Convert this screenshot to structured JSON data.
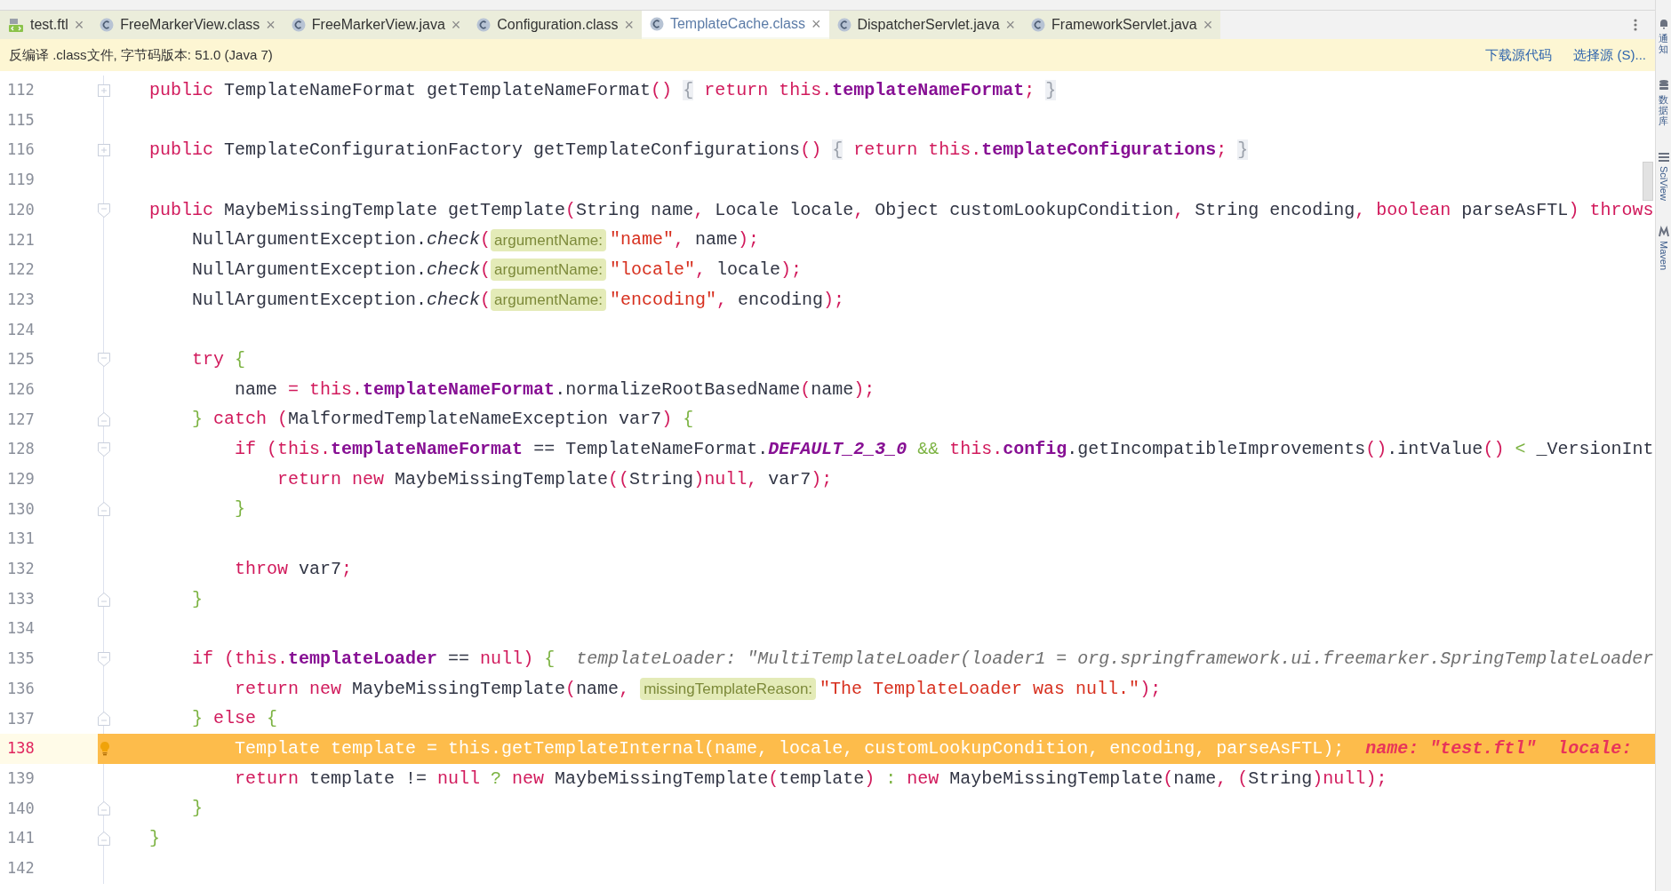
{
  "tabs": [
    {
      "label": "test.ftl",
      "kind": "ftl",
      "close": "×",
      "selected": false
    },
    {
      "label": "FreeMarkerView.class",
      "kind": "class",
      "close": "×",
      "selected": false
    },
    {
      "label": "FreeMarkerView.java",
      "kind": "class",
      "close": "×",
      "selected": false
    },
    {
      "label": "Configuration.class",
      "kind": "class",
      "close": "×",
      "selected": false
    },
    {
      "label": "TemplateCache.class",
      "kind": "class",
      "close": "×",
      "selected": true
    },
    {
      "label": "DispatcherServlet.java",
      "kind": "class",
      "close": "×",
      "selected": false
    },
    {
      "label": "FrameworkServlet.java",
      "kind": "class",
      "close": "×",
      "selected": false
    }
  ],
  "notice": {
    "text": "反编译 .class文件, 字节码版本: 51.0 (Java 7)",
    "actions": [
      "下载源代码",
      "选择源 (S)..."
    ]
  },
  "side_tools": [
    {
      "label": "通知",
      "kind": "bell"
    },
    {
      "label": "数据库",
      "kind": "database"
    },
    {
      "label": "SciView",
      "kind": "grid"
    },
    {
      "label": "Maven",
      "kind": "maven"
    }
  ],
  "lines": [
    {
      "number": "112",
      "kind": "collapsed",
      "current": false,
      "tokens": [
        {
          "kind": "kw",
          "text": "public"
        },
        {
          "kind": "plain",
          "text": " TemplateNameFormat getTemplateNameFormat"
        },
        {
          "kind": "paren",
          "text": "() "
        },
        {
          "kind": "folded",
          "text": "{"
        },
        {
          "kind": "kw",
          "text": " return this"
        },
        {
          "kind": "paren",
          "text": "."
        },
        {
          "kind": "field",
          "text": "templateNameFormat"
        },
        {
          "kind": "paren",
          "text": "; "
        },
        {
          "kind": "folded",
          "text": "}"
        }
      ]
    },
    {
      "number": "115",
      "kind": "plain",
      "current": false
    },
    {
      "number": "116",
      "kind": "collapsed",
      "current": false,
      "tokens": [
        {
          "kind": "kw",
          "text": "public"
        },
        {
          "kind": "plain",
          "text": " TemplateConfigurationFactory getTemplateConfigurations"
        },
        {
          "kind": "paren",
          "text": "() "
        },
        {
          "kind": "folded",
          "text": "{"
        },
        {
          "kind": "kw",
          "text": " return this"
        },
        {
          "kind": "paren",
          "text": "."
        },
        {
          "kind": "field",
          "text": "templateConfigurations"
        },
        {
          "kind": "paren",
          "text": "; "
        },
        {
          "kind": "folded",
          "text": "}"
        }
      ]
    },
    {
      "number": "119",
      "kind": "plain",
      "current": false
    },
    {
      "number": "120",
      "kind": "fold_start",
      "current": false,
      "tokens": [
        {
          "kind": "kw",
          "text": "public"
        },
        {
          "kind": "plain",
          "text": " MaybeMissingTemplate getTemplate"
        },
        {
          "kind": "paren",
          "text": "("
        },
        {
          "kind": "plain",
          "text": "String name"
        },
        {
          "kind": "paren",
          "text": ","
        },
        {
          "kind": "plain",
          "text": " Locale locale"
        },
        {
          "kind": "paren",
          "text": ","
        },
        {
          "kind": "plain",
          "text": " Object customLookupCondition"
        },
        {
          "kind": "paren",
          "text": ","
        },
        {
          "kind": "plain",
          "text": " String encoding"
        },
        {
          "kind": "paren",
          "text": ","
        },
        {
          "kind": "kw",
          "text": " boolean"
        },
        {
          "kind": "plain",
          "text": " parseAsFTL"
        },
        {
          "kind": "paren",
          "text": ")"
        },
        {
          "kind": "kw",
          "text": " throws"
        }
      ]
    },
    {
      "number": "121",
      "kind": "plain",
      "current": false,
      "tokens": [
        {
          "kind": "plain",
          "text": "    NullArgumentException."
        },
        {
          "kind": "italic",
          "text": "check"
        },
        {
          "kind": "paren",
          "text": "("
        },
        {
          "kind": "hint",
          "text": "argumentName:"
        },
        {
          "kind": "str",
          "text": "\"name\""
        },
        {
          "kind": "paren",
          "text": ","
        },
        {
          "kind": "plain",
          "text": " name"
        },
        {
          "kind": "paren",
          "text": ");"
        }
      ]
    },
    {
      "number": "122",
      "kind": "plain",
      "current": false,
      "tokens": [
        {
          "kind": "plain",
          "text": "    NullArgumentException."
        },
        {
          "kind": "italic",
          "text": "check"
        },
        {
          "kind": "paren",
          "text": "("
        },
        {
          "kind": "hint",
          "text": "argumentName:"
        },
        {
          "kind": "str",
          "text": "\"locale\""
        },
        {
          "kind": "paren",
          "text": ","
        },
        {
          "kind": "plain",
          "text": " locale"
        },
        {
          "kind": "paren",
          "text": ");"
        }
      ]
    },
    {
      "number": "123",
      "kind": "plain",
      "current": false,
      "tokens": [
        {
          "kind": "plain",
          "text": "    NullArgumentException."
        },
        {
          "kind": "italic",
          "text": "check"
        },
        {
          "kind": "paren",
          "text": "("
        },
        {
          "kind": "hint",
          "text": "argumentName:"
        },
        {
          "kind": "str",
          "text": "\"encoding\""
        },
        {
          "kind": "paren",
          "text": ","
        },
        {
          "kind": "plain",
          "text": " encoding"
        },
        {
          "kind": "paren",
          "text": ");"
        }
      ]
    },
    {
      "number": "124",
      "kind": "plain",
      "current": false
    },
    {
      "number": "125",
      "kind": "fold_start",
      "current": false,
      "tokens": [
        {
          "kind": "kw",
          "text": "    try"
        },
        {
          "kind": "green",
          "text": " {"
        }
      ]
    },
    {
      "number": "126",
      "kind": "plain",
      "current": false,
      "tokens": [
        {
          "kind": "plain",
          "text": "        name "
        },
        {
          "kind": "paren",
          "text": "="
        },
        {
          "kind": "kw",
          "text": " this"
        },
        {
          "kind": "paren",
          "text": "."
        },
        {
          "kind": "field",
          "text": "templateNameFormat"
        },
        {
          "kind": "plain",
          "text": ".normalizeRootBasedName"
        },
        {
          "kind": "paren",
          "text": "("
        },
        {
          "kind": "plain",
          "text": "name"
        },
        {
          "kind": "paren",
          "text": ");"
        }
      ]
    },
    {
      "number": "127",
      "kind": "fold_end",
      "current": false,
      "tokens": [
        {
          "kind": "green",
          "text": "    }"
        },
        {
          "kind": "kw",
          "text": " catch"
        },
        {
          "kind": "paren",
          "text": " ("
        },
        {
          "kind": "plain",
          "text": "MalformedTemplateNameException var7"
        },
        {
          "kind": "paren",
          "text": ")"
        },
        {
          "kind": "green",
          "text": " {"
        }
      ]
    },
    {
      "number": "128",
      "kind": "fold_start",
      "current": false,
      "tokens": [
        {
          "kind": "kw",
          "text": "        if"
        },
        {
          "kind": "paren",
          "text": " ("
        },
        {
          "kind": "kw",
          "text": "this"
        },
        {
          "kind": "paren",
          "text": "."
        },
        {
          "kind": "field",
          "text": "templateNameFormat"
        },
        {
          "kind": "plain",
          "text": " == TemplateNameFormat."
        },
        {
          "kind": "constant",
          "text": "DEFAULT_2_3_0"
        },
        {
          "kind": "green",
          "text": " &&"
        },
        {
          "kind": "kw",
          "text": " this"
        },
        {
          "kind": "paren",
          "text": "."
        },
        {
          "kind": "field",
          "text": "config"
        },
        {
          "kind": "plain",
          "text": ".getIncompatibleImprovements"
        },
        {
          "kind": "paren",
          "text": "()"
        },
        {
          "kind": "plain",
          "text": ".intValue"
        },
        {
          "kind": "paren",
          "text": "()"
        },
        {
          "kind": "green",
          "text": " <"
        },
        {
          "kind": "plain",
          "text": " _VersionInt"
        }
      ]
    },
    {
      "number": "129",
      "kind": "plain",
      "current": false,
      "tokens": [
        {
          "kind": "kw",
          "text": "            return new"
        },
        {
          "kind": "plain",
          "text": " MaybeMissingTemplate"
        },
        {
          "kind": "paren",
          "text": "(("
        },
        {
          "kind": "plain",
          "text": "String"
        },
        {
          "kind": "paren",
          "text": ")"
        },
        {
          "kind": "kw",
          "text": "null"
        },
        {
          "kind": "paren",
          "text": ","
        },
        {
          "kind": "plain",
          "text": " var7"
        },
        {
          "kind": "paren",
          "text": ");"
        }
      ]
    },
    {
      "number": "130",
      "kind": "fold_end",
      "current": false,
      "tokens": [
        {
          "kind": "green",
          "text": "        }"
        }
      ]
    },
    {
      "number": "131",
      "kind": "plain",
      "current": false
    },
    {
      "number": "132",
      "kind": "plain",
      "current": false,
      "tokens": [
        {
          "kind": "kw",
          "text": "        throw"
        },
        {
          "kind": "plain",
          "text": " var7"
        },
        {
          "kind": "paren",
          "text": ";"
        }
      ]
    },
    {
      "number": "133",
      "kind": "fold_end",
      "current": false,
      "tokens": [
        {
          "kind": "green",
          "text": "    }"
        }
      ]
    },
    {
      "number": "134",
      "kind": "plain",
      "current": false
    },
    {
      "number": "135",
      "kind": "fold_start",
      "current": false,
      "tokens": [
        {
          "kind": "kw",
          "text": "    if"
        },
        {
          "kind": "paren",
          "text": " ("
        },
        {
          "kind": "kw",
          "text": "this"
        },
        {
          "kind": "paren",
          "text": "."
        },
        {
          "kind": "field",
          "text": "templateLoader"
        },
        {
          "kind": "plain",
          "text": " =="
        },
        {
          "kind": "kw",
          "text": " null"
        },
        {
          "kind": "paren",
          "text": ")"
        },
        {
          "kind": "green",
          "text": " {"
        },
        {
          "kind": "debug",
          "text": "templateLoader: \"MultiTemplateLoader(loader1 = org.springframework.ui.freemarker.SpringTemplateLoader"
        }
      ]
    },
    {
      "number": "136",
      "kind": "plain",
      "current": false,
      "tokens": [
        {
          "kind": "kw",
          "text": "        return new"
        },
        {
          "kind": "plain",
          "text": " MaybeMissingTemplate"
        },
        {
          "kind": "paren",
          "text": "("
        },
        {
          "kind": "plain",
          "text": "name"
        },
        {
          "kind": "paren",
          "text": ", "
        },
        {
          "kind": "hint",
          "text": "missingTemplateReason:"
        },
        {
          "kind": "str",
          "text": "\"The TemplateLoader was null.\""
        },
        {
          "kind": "paren",
          "text": ");"
        }
      ]
    },
    {
      "number": "137",
      "kind": "fold_end",
      "current": false,
      "tokens": [
        {
          "kind": "green",
          "text": "    }"
        },
        {
          "kind": "kw",
          "text": " else"
        },
        {
          "kind": "green",
          "text": " {"
        }
      ]
    },
    {
      "number": "138",
      "kind": "plain",
      "current": true,
      "tokens": [
        {
          "kind": "plain",
          "text": "        Template template = this.getTemplateInternal(name, locale, customLookupCondition, encoding, parseAsFTL);"
        },
        {
          "kind": "debug_value",
          "text": "name: \"test.ftl\""
        },
        {
          "kind": "debug_value",
          "text": "locale:"
        }
      ]
    },
    {
      "number": "139",
      "kind": "plain",
      "current": false,
      "tokens": [
        {
          "kind": "kw",
          "text": "        return"
        },
        {
          "kind": "plain",
          "text": " template !="
        },
        {
          "kind": "kw",
          "text": " null"
        },
        {
          "kind": "green",
          "text": " ?"
        },
        {
          "kind": "kw",
          "text": " new"
        },
        {
          "kind": "plain",
          "text": " MaybeMissingTemplate"
        },
        {
          "kind": "paren",
          "text": "("
        },
        {
          "kind": "plain",
          "text": "template"
        },
        {
          "kind": "paren",
          "text": ")"
        },
        {
          "kind": "green",
          "text": " :"
        },
        {
          "kind": "kw",
          "text": " new"
        },
        {
          "kind": "plain",
          "text": " MaybeMissingTemplate"
        },
        {
          "kind": "paren",
          "text": "("
        },
        {
          "kind": "plain",
          "text": "name"
        },
        {
          "kind": "paren",
          "text": ", ("
        },
        {
          "kind": "plain",
          "text": "String"
        },
        {
          "kind": "paren",
          "text": ")"
        },
        {
          "kind": "kw",
          "text": "null"
        },
        {
          "kind": "paren",
          "text": ");"
        }
      ]
    },
    {
      "number": "140",
      "kind": "fold_end",
      "current": false,
      "tokens": [
        {
          "kind": "green",
          "text": "    }"
        }
      ]
    },
    {
      "number": "141",
      "kind": "fold_end",
      "current": false,
      "tokens": [
        {
          "kind": "green",
          "text": "}"
        }
      ]
    },
    {
      "number": "142",
      "kind": "plain",
      "current": false
    }
  ]
}
